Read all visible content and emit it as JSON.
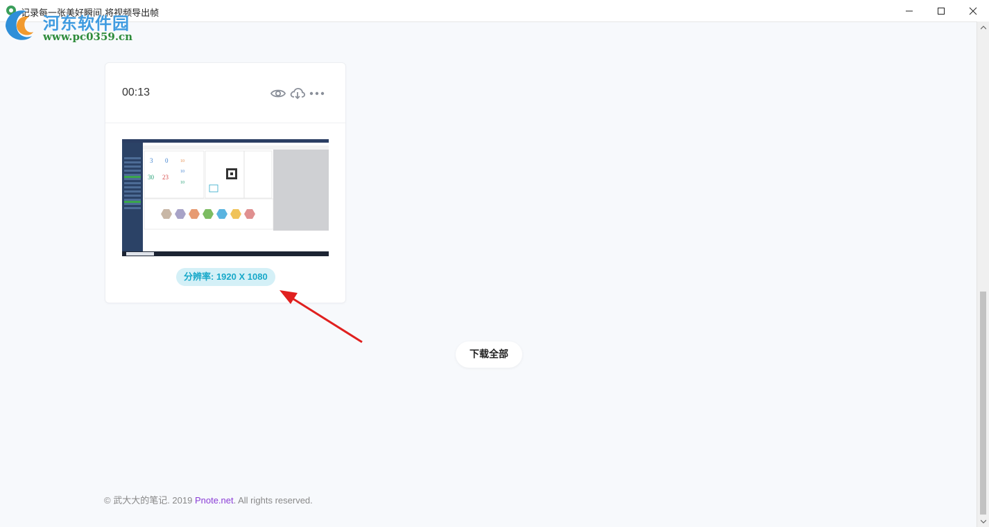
{
  "window": {
    "title": "记录每一张美好瞬间,将视频导出帧",
    "minimize_label": "minimize",
    "maximize_label": "maximize",
    "close_label": "close"
  },
  "watermark": {
    "line1": "河东软件园",
    "line2": "www.pc0359.cn"
  },
  "card": {
    "duration": "00:13",
    "icons": [
      "eye-icon",
      "cloud-download-icon",
      "more-icon"
    ],
    "resolution": "分辨率: 1920 X 1080"
  },
  "download_all_label": "下载全部",
  "footer": {
    "prefix": "© 武大大的笔记. 2019 ",
    "brand": "Pnote.net",
    "suffix": ". All rights reserved."
  },
  "colors": {
    "accent": "#17a8c9",
    "badge_bg": "#d4f0f7",
    "brand_link": "#8a3cd6",
    "arrow": "#e0201f"
  }
}
